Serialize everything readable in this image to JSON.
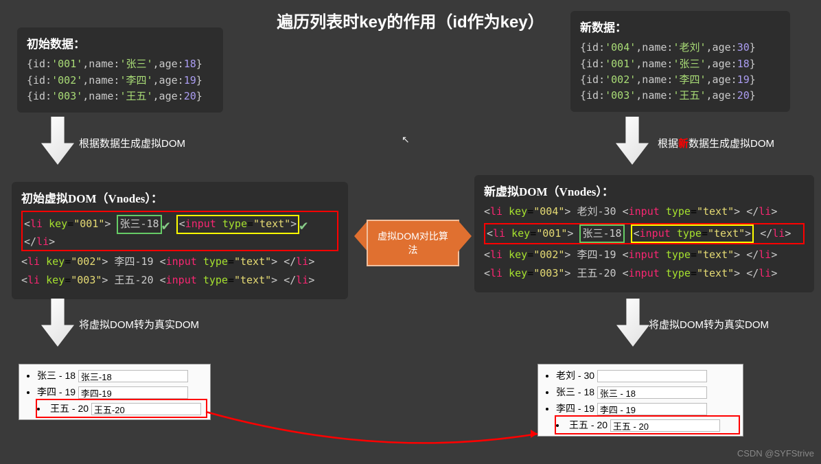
{
  "title": "遍历列表时key的作用（id作为key）",
  "left": {
    "initDataTitle": "初始数据：",
    "initData": [
      {
        "id": "001",
        "name": "张三",
        "age": 18
      },
      {
        "id": "002",
        "name": "李四",
        "age": 19
      },
      {
        "id": "003",
        "name": "王五",
        "age": 20
      }
    ],
    "arrow1": "根据数据生成虚拟DOM",
    "vdomTitle": "初始虚拟DOM（Vnodes）：",
    "vdom": [
      {
        "key": "001",
        "text": "张三-18",
        "highlight": true
      },
      {
        "key": "002",
        "text": "李四-19",
        "highlight": false
      },
      {
        "key": "003",
        "text": "王五-20",
        "highlight": false
      }
    ],
    "arrow2": "将虚拟DOM转为真实DOM",
    "realDom": [
      {
        "label": "张三 - 18",
        "input": "张三-18"
      },
      {
        "label": "李四 - 19",
        "input": "李四-19"
      },
      {
        "label": "王五 - 20",
        "input": "王五-20",
        "hl": true
      }
    ]
  },
  "center": "虚拟DOM对比算法",
  "right": {
    "newDataTitle": "新数据：",
    "newData": [
      {
        "id": "004",
        "name": "老刘",
        "age": 30
      },
      {
        "id": "001",
        "name": "张三",
        "age": 18
      },
      {
        "id": "002",
        "name": "李四",
        "age": 19
      },
      {
        "id": "003",
        "name": "王五",
        "age": 20
      }
    ],
    "arrow1pre": "根据",
    "arrow1mid": "新",
    "arrow1post": "数据生成虚拟DOM",
    "vdomTitle": "新虚拟DOM（Vnodes）：",
    "vdom": [
      {
        "key": "004",
        "text": "老刘-30",
        "highlight": false
      },
      {
        "key": "001",
        "text": "张三-18",
        "highlight": true
      },
      {
        "key": "002",
        "text": "李四-19",
        "highlight": false
      },
      {
        "key": "003",
        "text": "王五-20",
        "highlight": false
      }
    ],
    "arrow2": "将虚拟DOM转为真实DOM",
    "realDom": [
      {
        "label": "老刘 - 30",
        "input": ""
      },
      {
        "label": "张三 - 18",
        "input": "张三 - 18"
      },
      {
        "label": "李四 - 19",
        "input": "李四 - 19"
      },
      {
        "label": "王五 - 20",
        "input": "王五 - 20",
        "hl": true
      }
    ]
  },
  "watermark": "CSDN @SYFStrive"
}
